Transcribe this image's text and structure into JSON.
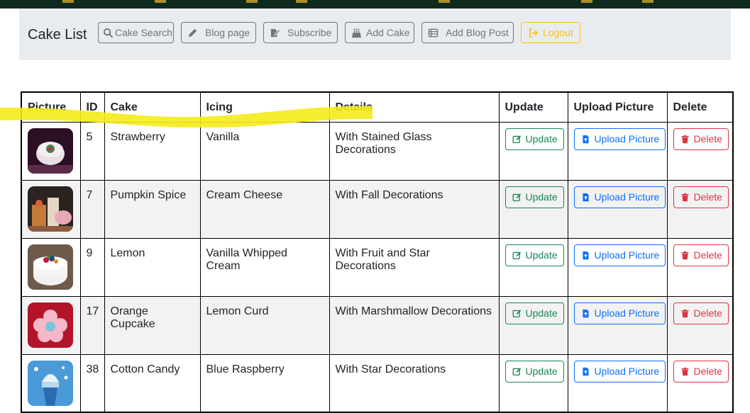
{
  "navbar": {
    "brand": "Cake List",
    "buttons": [
      {
        "label": "Cake Search",
        "icon": "search-icon"
      },
      {
        "label": "Blog page",
        "icon": "pencil-icon"
      },
      {
        "label": "Subscribe",
        "icon": "pen-to-square-icon"
      },
      {
        "label": "Add Cake",
        "icon": "cake-icon"
      },
      {
        "label": "Add Blog Post",
        "icon": "table-list-icon"
      },
      {
        "label": "Logout",
        "icon": "logout-icon"
      }
    ]
  },
  "table": {
    "headers": [
      "Picture",
      "ID",
      "Cake",
      "Icing",
      "Details",
      "Update",
      "Upload Picture",
      "Delete"
    ],
    "rows": [
      {
        "id": "5",
        "cake": "Strawberry",
        "icing": "Vanilla",
        "details": "With Stained Glass Decorations",
        "update": "Update",
        "upload": "Upload Picture",
        "delete": "Delete"
      },
      {
        "id": "7",
        "cake": "Pumpkin Spice",
        "icing": "Cream Cheese",
        "details": "With Fall Decorations",
        "update": "Update",
        "upload": "Upload Picture",
        "delete": "Delete"
      },
      {
        "id": "9",
        "cake": "Lemon",
        "icing": "Vanilla Whipped Cream",
        "details": "With Fruit and Star Decorations",
        "update": "Update",
        "upload": "Upload Picture",
        "delete": "Delete"
      },
      {
        "id": "17",
        "cake": "Orange Cupcake",
        "icing": "Lemon Curd",
        "details": "With Marshmallow Decorations",
        "update": "Update",
        "upload": "Upload Picture",
        "delete": "Delete"
      },
      {
        "id": "38",
        "cake": "Cotton Candy",
        "icing": "Blue Raspberry",
        "details": "With Star Decorations",
        "update": "Update",
        "upload": "Upload Picture",
        "delete": "Delete"
      }
    ]
  },
  "colors": {
    "update": "#198754",
    "upload": "#0d6efd",
    "delete": "#dc3545",
    "logout": "#ffc107",
    "highlight": "#f5ea1a",
    "topstrip": "#0e2a1c"
  }
}
